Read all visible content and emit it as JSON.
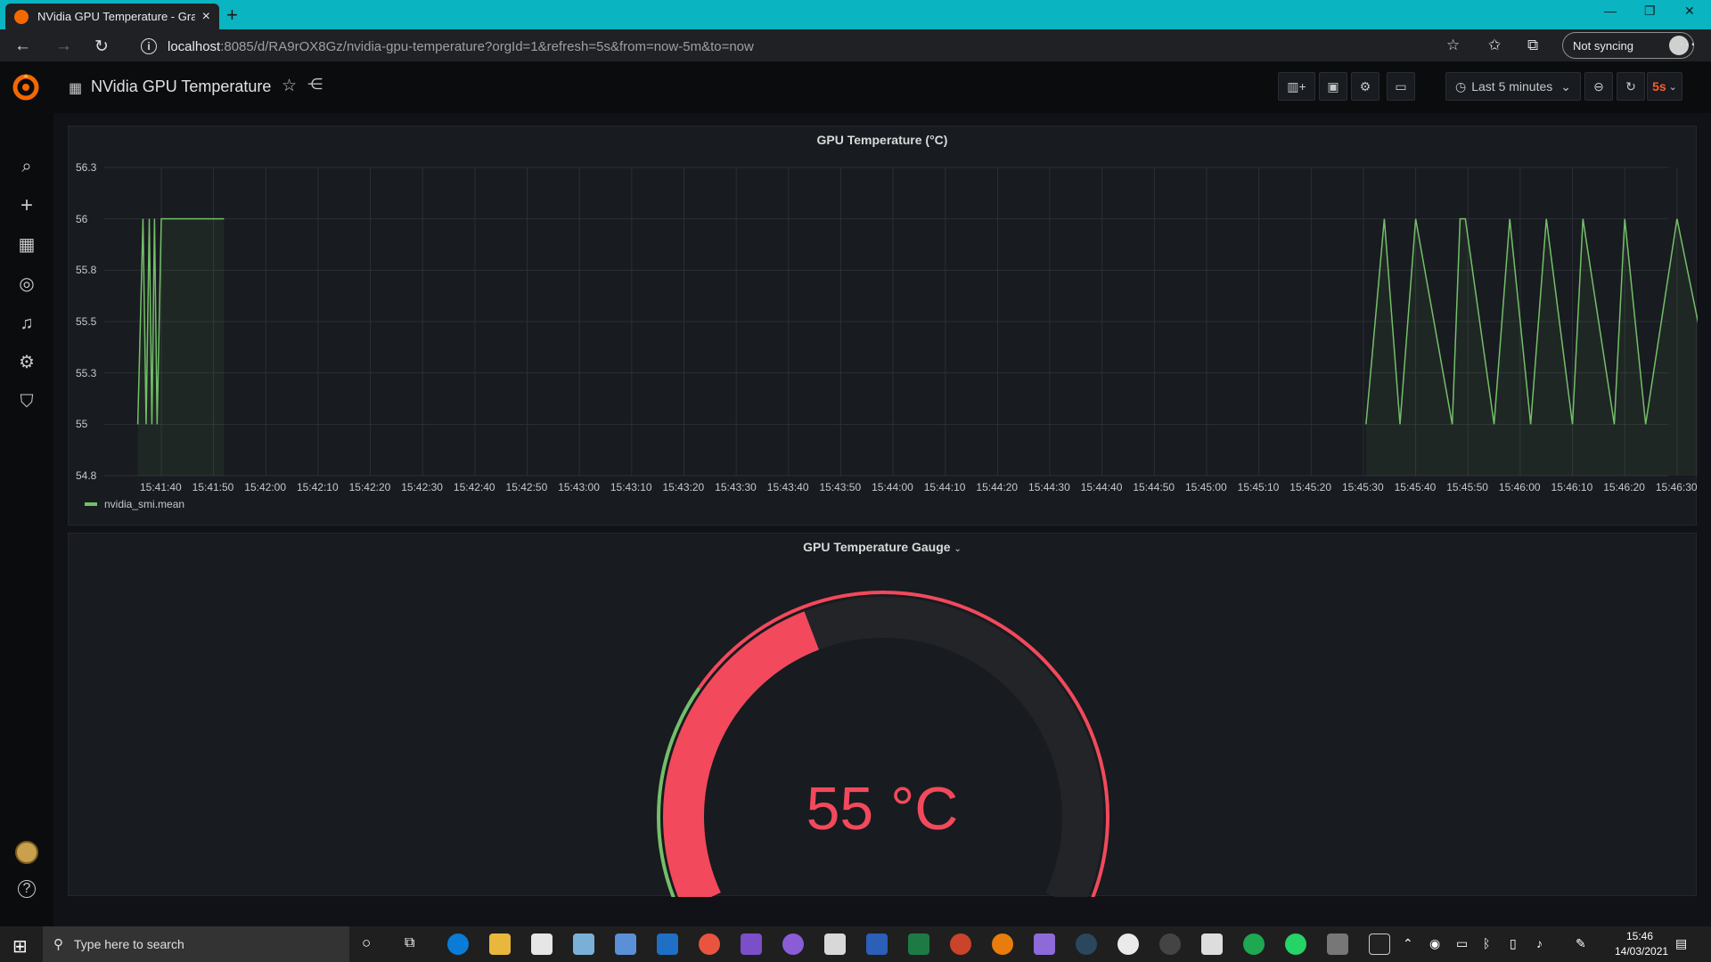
{
  "browser": {
    "tab_title": "NVidia GPU Temperature - Grafana",
    "tab_close": "×",
    "new_tab": "+",
    "url_host": "localhost",
    "url_path": ":8085/d/RA9rOX8Gz/nvidia-gpu-temperature?orgId=1&refresh=5s&from=now-5m&to=now",
    "sync_label": "Not syncing",
    "icons": [
      "back-icon",
      "forward-icon",
      "refresh-icon",
      "info-icon",
      "favorites-star-icon",
      "collections-icon",
      "more-icon"
    ]
  },
  "dashboard": {
    "title": "NVidia GPU Temperature",
    "time_range": "Last 5 minutes",
    "refresh_interval": "5s"
  },
  "panels": {
    "temp": {
      "title": "GPU Temperature (°C)",
      "legend": "nvidia_smi.mean",
      "y_ticks": [
        "56.3",
        "56",
        "55.8",
        "55.5",
        "55.3",
        "55",
        "54.8"
      ],
      "x_ticks": [
        "15:41:40",
        "15:41:50",
        "15:42:00",
        "15:42:10",
        "15:42:20",
        "15:42:30",
        "15:42:40",
        "15:42:50",
        "15:43:00",
        "15:43:10",
        "15:43:20",
        "15:43:30",
        "15:43:40",
        "15:43:50",
        "15:44:00",
        "15:44:10",
        "15:44:20",
        "15:44:30",
        "15:44:40",
        "15:44:50",
        "15:45:00",
        "15:45:10",
        "15:45:20",
        "15:45:30",
        "15:45:40",
        "15:45:50",
        "15:46:00",
        "15:46:10",
        "15:46:20",
        "15:46:30"
      ]
    },
    "gauge": {
      "title": "GPU Temperature Gauge",
      "value_text": "55 °C"
    }
  },
  "chart_data": {
    "type": "line",
    "title": "GPU Temperature (°C)",
    "ylim": [
      54.8,
      56.3
    ],
    "series": [
      {
        "name": "nvidia_smi.mean",
        "color": "#73bf69",
        "segments": [
          {
            "x": [
              -4.5,
              -3.5,
              -2.9,
              -2.3,
              -1.8,
              -1.3,
              -0.8,
              0,
              12.0
            ],
            "y": [
              55,
              56,
              55,
              56,
              55,
              56,
              55,
              56,
              56
            ]
          },
          {
            "x": [
              230.5,
              234,
              237,
              240,
              247,
              248.5,
              249.5,
              255,
              258,
              262,
              265,
              270,
              272,
              278,
              280,
              284,
              290,
              298,
              301,
              304,
              307,
              310
            ],
            "y": [
              55,
              56,
              55,
              56,
              55,
              56,
              56,
              55,
              56,
              55,
              56,
              55,
              56,
              55,
              56,
              55,
              56,
              55,
              56,
              55,
              56,
              55
            ]
          }
        ]
      }
    ]
  },
  "colors": {
    "series": "#73bf69",
    "gauge_red": "#f2495c",
    "gauge_green": "#73bf69",
    "refresh_orange": "#ff5b2b"
  },
  "taskbar": {
    "search_placeholder": "Type here to search",
    "time": "15:46",
    "date": "14/03/2021"
  }
}
